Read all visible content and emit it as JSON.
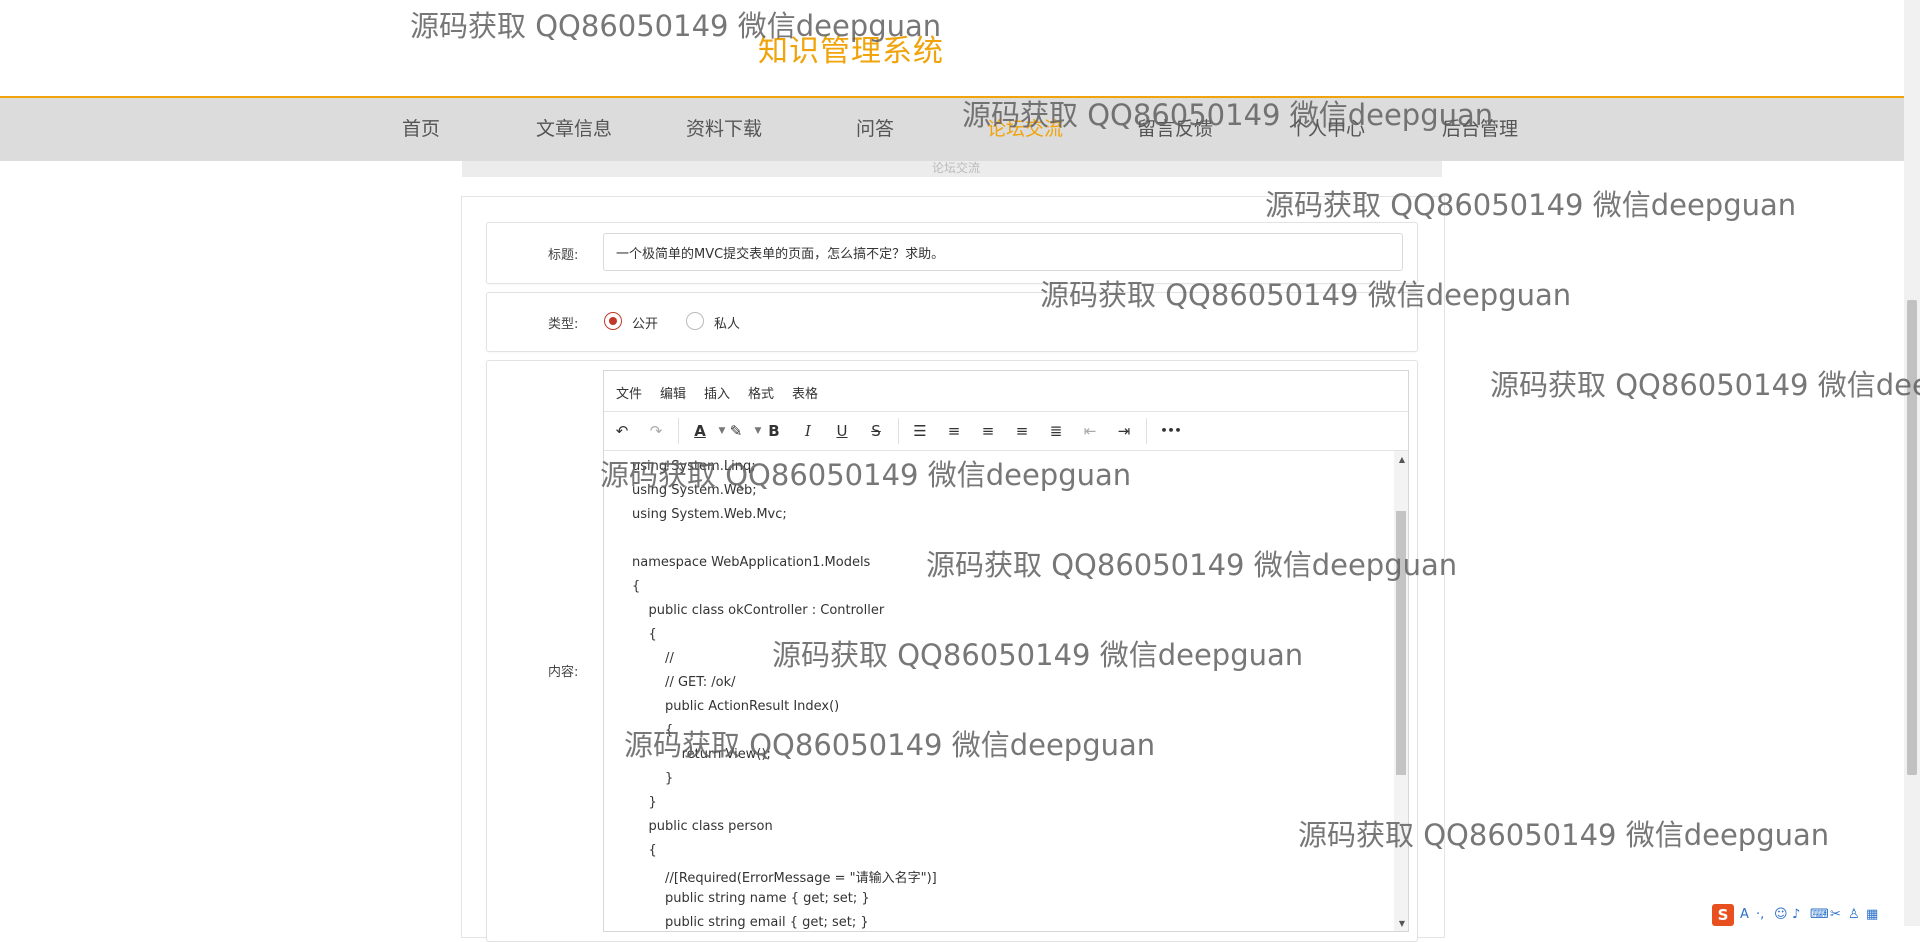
{
  "site": {
    "title": "知识管理系统"
  },
  "nav": {
    "items": [
      {
        "label": "首页"
      },
      {
        "label": "文章信息"
      },
      {
        "label": "资料下载"
      },
      {
        "label": "问答"
      },
      {
        "label": "论坛交流"
      },
      {
        "label": "留言反馈"
      },
      {
        "label": "个人中心"
      },
      {
        "label": "后台管理"
      }
    ],
    "active_index": 4,
    "active_color": "#f0a30a",
    "hidden_subtitle": "论坛交流"
  },
  "form": {
    "title_label": "标题:",
    "title_value": "一个极简单的MVC提交表单的页面，怎么搞不定？求助。",
    "type_label": "类型:",
    "type_options": [
      {
        "label": "公开",
        "checked": true
      },
      {
        "label": "私人",
        "checked": false
      }
    ],
    "content_label": "内容:"
  },
  "editor": {
    "menus": [
      "文件",
      "编辑",
      "插入",
      "格式",
      "表格"
    ],
    "toolbar": [
      {
        "icon": "undo-icon",
        "glyph": "↶",
        "enabled": true
      },
      {
        "icon": "redo-icon",
        "glyph": "↷",
        "enabled": false
      },
      {
        "icon": "text-color-icon",
        "glyph": "A",
        "enabled": true
      },
      {
        "icon": "highlight-icon",
        "glyph": "✎",
        "enabled": true
      },
      {
        "icon": "bold-icon",
        "glyph": "B",
        "enabled": true
      },
      {
        "icon": "italic-icon",
        "glyph": "I",
        "enabled": true
      },
      {
        "icon": "underline-icon",
        "glyph": "U",
        "enabled": true
      },
      {
        "icon": "strikethrough-icon",
        "glyph": "S",
        "enabled": true
      },
      {
        "icon": "line-height-icon",
        "glyph": "☰",
        "enabled": true
      },
      {
        "icon": "align-left-icon",
        "glyph": "≡",
        "enabled": true
      },
      {
        "icon": "align-center-icon",
        "glyph": "≡",
        "enabled": true
      },
      {
        "icon": "align-right-icon",
        "glyph": "≡",
        "enabled": true
      },
      {
        "icon": "align-justify-icon",
        "glyph": "≣",
        "enabled": true
      },
      {
        "icon": "outdent-icon",
        "glyph": "⇤",
        "enabled": false
      },
      {
        "icon": "indent-icon",
        "glyph": "⇥",
        "enabled": true
      },
      {
        "icon": "more-icon",
        "glyph": "•••",
        "enabled": true
      }
    ],
    "code_lines": [
      "using System.Linq;",
      "using System.Web;",
      "using System.Web.Mvc;",
      "",
      "namespace WebApplication1.Models",
      "{",
      "    public class okController : Controller",
      "    {",
      "        //",
      "        // GET: /ok/",
      "        public ActionResult Index()",
      "        {",
      "            return View();",
      "        }",
      "    }",
      "    public class person",
      "    {",
      "        //[Required(ErrorMessage = \"请输入名字\")]",
      "        public string name { get; set; }",
      "        public string email { get; set; }"
    ]
  },
  "watermark": {
    "text": "源码获取 QQ86050149 微信deepguan",
    "count": 10
  },
  "ime": {
    "logo": "S"
  }
}
